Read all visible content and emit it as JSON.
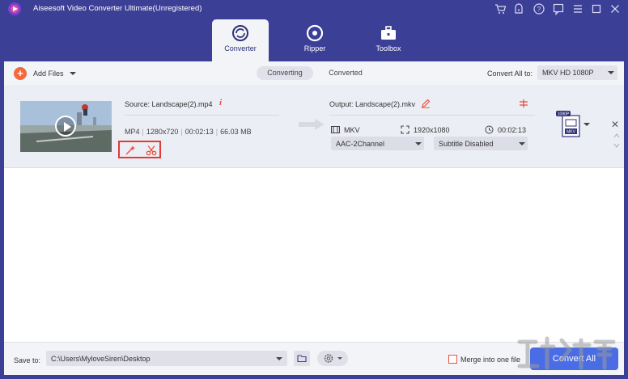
{
  "app": {
    "title": "Aiseesoft Video Converter Ultimate(Unregistered)"
  },
  "tabs": [
    {
      "label": "Converter",
      "icon": "converter-icon",
      "active": true
    },
    {
      "label": "Ripper",
      "icon": "disc-icon",
      "active": false
    },
    {
      "label": "Toolbox",
      "icon": "toolbox-icon",
      "active": false
    }
  ],
  "toolbar": {
    "add_files": "Add Files",
    "segments": [
      "Converting",
      "Converted"
    ],
    "convert_all_to_label": "Convert All to:",
    "convert_all_to_value": "MKV HD 1080P"
  },
  "file": {
    "source": "Source: Landscape(2).mp4",
    "format": "MP4",
    "resolution": "1280x720",
    "duration": "00:02:13",
    "size": "66.03 MB",
    "output": "Output: Landscape(2).mkv",
    "out_format": "MKV",
    "out_resolution": "1920x1080",
    "out_duration": "00:02:13",
    "audio": "AAC-2Channel",
    "subtitle": "Subtitle Disabled",
    "badge_top": "1080P",
    "badge_bottom": "MKV"
  },
  "bottom": {
    "save_to_label": "Save to:",
    "save_path": "C:\\Users\\MyloveSiren\\Desktop",
    "merge_label": "Merge into one file",
    "convert_all": "Convert All"
  },
  "colors": {
    "accent": "#4a6de5",
    "header": "#3c3f96",
    "highlight": "#e53935",
    "orange": "#f26a3b"
  }
}
